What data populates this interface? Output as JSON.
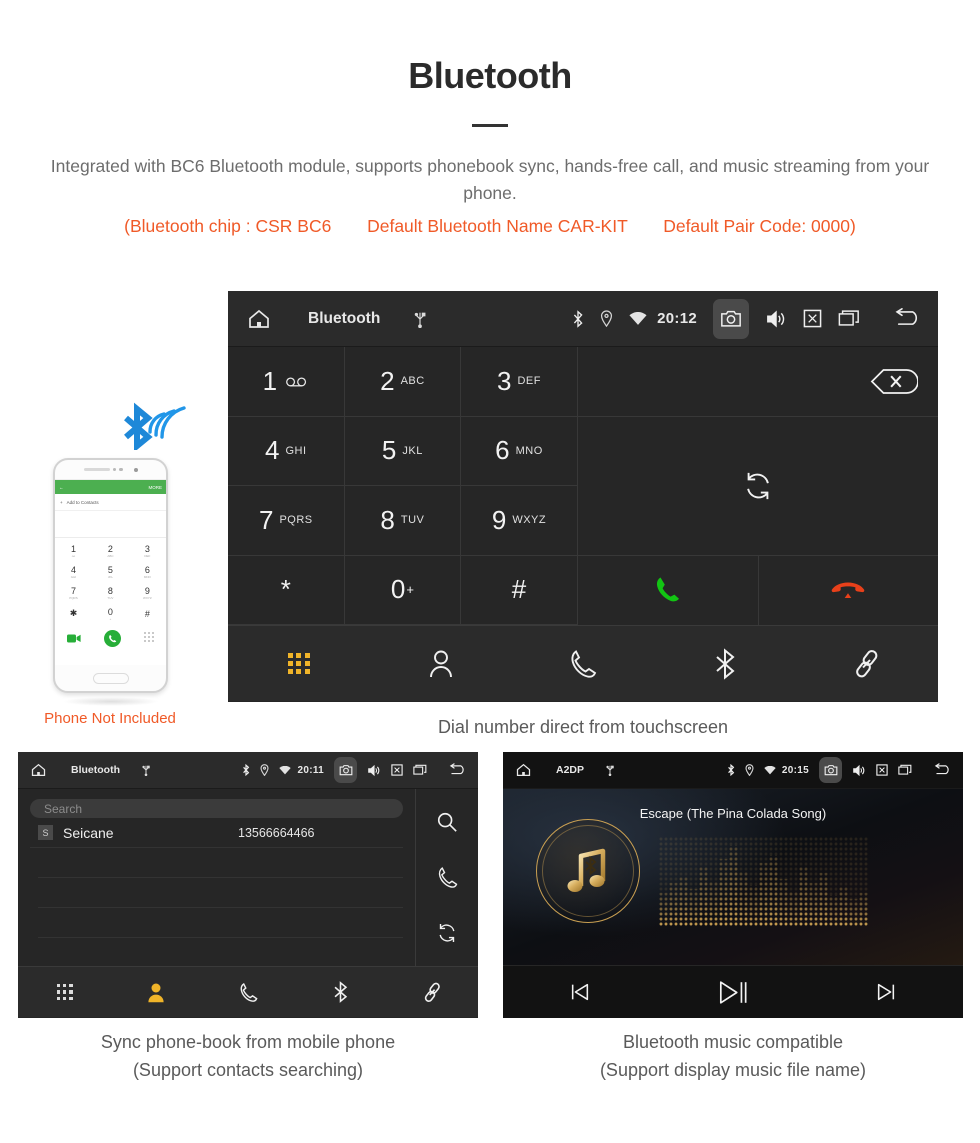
{
  "header": {
    "title": "Bluetooth",
    "intro": "Integrated with BC6 Bluetooth module, supports phonebook sync, hands-free call, and music streaming from your phone.",
    "spec_open": "(Bluetooth chip : CSR BC6",
    "spec_name": "Default Bluetooth Name CAR-KIT",
    "spec_pair": "Default Pair Code: 0000)",
    "accent_color": "#f05a28",
    "text_color": "#6d6d6d"
  },
  "dialer": {
    "statusbar": {
      "home_icon": "home-icon",
      "title": "Bluetooth",
      "usb_icon": "usb-icon",
      "bluetooth_icon": "bluetooth-icon",
      "location_icon": "location-icon",
      "wifi_icon": "wifi-icon",
      "time": "20:12",
      "camera_icon": "camera-icon",
      "volume_icon": "volume-icon",
      "close_icon": "close-box-icon",
      "recents_icon": "recents-icon",
      "back_icon": "back-icon"
    },
    "keys": [
      {
        "num": "1",
        "sub": "",
        "voicemail": true
      },
      {
        "num": "2",
        "sub": "ABC",
        "voicemail": false
      },
      {
        "num": "3",
        "sub": "DEF",
        "voicemail": false
      },
      {
        "num": "4",
        "sub": "GHI",
        "voicemail": false
      },
      {
        "num": "5",
        "sub": "JKL",
        "voicemail": false
      },
      {
        "num": "6",
        "sub": "MNO",
        "voicemail": false
      },
      {
        "num": "7",
        "sub": "PQRS",
        "voicemail": false
      },
      {
        "num": "8",
        "sub": "TUV",
        "voicemail": false
      },
      {
        "num": "9",
        "sub": "WXYZ",
        "voicemail": false
      },
      {
        "num": "*",
        "sub": "",
        "voicemail": false
      },
      {
        "num": "0",
        "sub": "",
        "sup": "+",
        "voicemail": false
      },
      {
        "num": "#",
        "sub": "",
        "voicemail": false
      }
    ],
    "backspace_icon": "backspace-icon",
    "transfer_icon": "transfer-sync-icon",
    "call_icon": "call-icon",
    "call_color": "#12c413",
    "hangup_icon": "hangup-icon",
    "hangup_color": "#e8401a",
    "navbar": [
      {
        "icon": "keypad-icon",
        "active": true
      },
      {
        "icon": "contacts-icon",
        "active": false
      },
      {
        "icon": "call-log-icon",
        "active": false
      },
      {
        "icon": "bluetooth-icon",
        "active": false
      },
      {
        "icon": "link-icon",
        "active": false
      }
    ],
    "active_color": "#f0b429",
    "caption": "Dial number direct from touchscreen"
  },
  "phone_mock": {
    "header_back_icon": "back-arrow-icon",
    "header_more_label": "MORE",
    "add_to_contacts_label": "Add to Contacts",
    "plus_icon": "plus-icon",
    "keys": [
      {
        "num": "1",
        "sub": "oo"
      },
      {
        "num": "2",
        "sub": "ABC"
      },
      {
        "num": "3",
        "sub": "DEF"
      },
      {
        "num": "4",
        "sub": "GHI"
      },
      {
        "num": "5",
        "sub": "JKL"
      },
      {
        "num": "6",
        "sub": "MNO"
      },
      {
        "num": "7",
        "sub": "PQRS"
      },
      {
        "num": "8",
        "sub": "TUV"
      },
      {
        "num": "9",
        "sub": "WXYZ"
      },
      {
        "num": "✱",
        "sub": ""
      },
      {
        "num": "0",
        "sub": "+"
      },
      {
        "num": "#",
        "sub": ""
      }
    ],
    "video_call_icon": "video-call-icon",
    "call_icon": "call-icon",
    "keyboard_icon": "keyboard-icon",
    "bt_signal_icon": "bluetooth-signal-icon",
    "bt_signal_color": "#2196e8",
    "disclaimer": "Phone Not Included",
    "disclaimer_color": "#f05a28"
  },
  "phonebook": {
    "statusbar": {
      "home_icon": "home-icon",
      "title": "Bluetooth",
      "usb_icon": "usb-icon",
      "time": "20:11"
    },
    "search_placeholder": "Search",
    "contacts": [
      {
        "initial": "S",
        "name": "Seicane",
        "number": "13566664466"
      }
    ],
    "side_actions": [
      {
        "icon": "search-icon"
      },
      {
        "icon": "call-icon"
      },
      {
        "icon": "sync-icon"
      }
    ],
    "navbar": [
      {
        "icon": "keypad-icon",
        "active": false
      },
      {
        "icon": "contacts-icon",
        "active": true
      },
      {
        "icon": "call-log-icon",
        "active": false
      },
      {
        "icon": "bluetooth-icon",
        "active": false
      },
      {
        "icon": "link-icon",
        "active": false
      }
    ],
    "caption_line1": "Sync phone-book from mobile phone",
    "caption_line2": "(Support contacts searching)"
  },
  "music": {
    "statusbar": {
      "home_icon": "home-icon",
      "title": "A2DP",
      "usb_icon": "usb-icon",
      "time": "20:15"
    },
    "track_title": "Escape (The Pina Colada Song)",
    "album_icon": "music-note-bluetooth-icon",
    "equalizer_icon": "dot-matrix-equalizer",
    "gold_color": "#caa052",
    "controls": [
      {
        "icon": "previous-track-icon"
      },
      {
        "icon": "play-pause-icon"
      },
      {
        "icon": "next-track-icon"
      }
    ],
    "caption_line1": "Bluetooth music compatible",
    "caption_line2": "(Support display music file name)"
  }
}
